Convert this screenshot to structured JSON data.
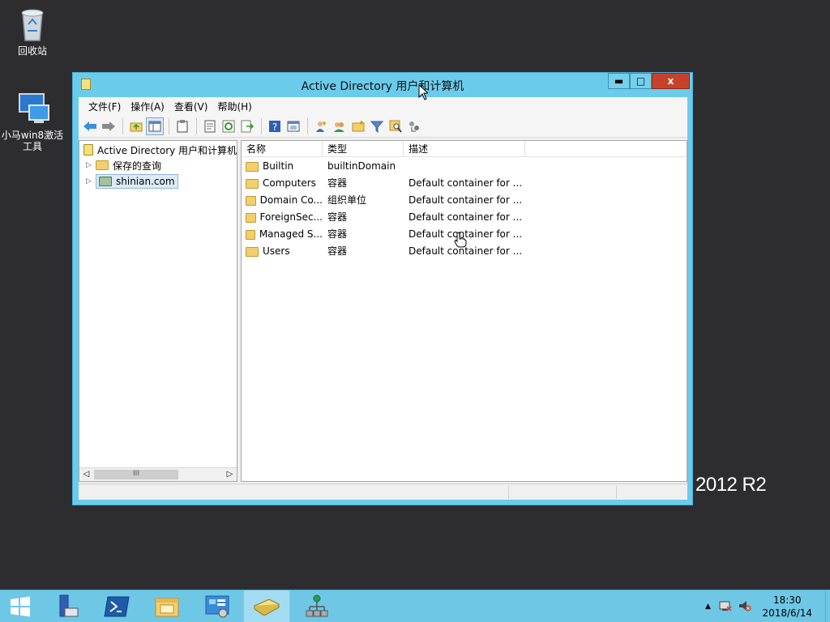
{
  "desktop": {
    "recycle_bin": "回收站",
    "tool_label": "小马win8激活工具",
    "os_watermark": "2012 R2"
  },
  "window": {
    "title": "Active Directory 用户和计算机",
    "min_label": "▬",
    "max_label": "□",
    "close_label": "x"
  },
  "menu": [
    "文件(F)",
    "操作(A)",
    "查看(V)",
    "帮助(H)"
  ],
  "toolbar_icons": [
    "back-arrow-icon",
    "forward-arrow-icon",
    "up-folder-icon",
    "show-hide-tree-icon",
    "clipboard-icon",
    "properties-icon",
    "refresh-icon",
    "export-list-icon",
    "help-icon",
    "console-icon",
    "new-user-icon",
    "new-group-icon",
    "new-ou-icon",
    "filter-icon",
    "find-icon",
    "delegate-icon"
  ],
  "tree": {
    "root": "Active Directory 用户和计算机",
    "items": [
      {
        "label": "保存的查询"
      },
      {
        "label": "shinian.com"
      }
    ]
  },
  "list": {
    "columns": [
      "名称",
      "类型",
      "描述"
    ],
    "rows": [
      {
        "name": "Builtin",
        "type": "builtinDomain",
        "desc": ""
      },
      {
        "name": "Computers",
        "type": "容器",
        "desc": "Default container for ..."
      },
      {
        "name": "Domain Co...",
        "type": "组织单位",
        "desc": "Default container for ..."
      },
      {
        "name": "ForeignSec...",
        "type": "容器",
        "desc": "Default container for ..."
      },
      {
        "name": "Managed S...",
        "type": "容器",
        "desc": "Default container for ..."
      },
      {
        "name": "Users",
        "type": "容器",
        "desc": "Default container for ..."
      }
    ]
  },
  "taskbar": {
    "clock_time": "18:30",
    "clock_date": "2018/6/14",
    "tray_up_label": "▲"
  },
  "colors": {
    "window_frame": "#6bcbea",
    "taskbar": "#6fc7e6",
    "close_button": "#c7422a",
    "desktop": "#2d2d30"
  }
}
